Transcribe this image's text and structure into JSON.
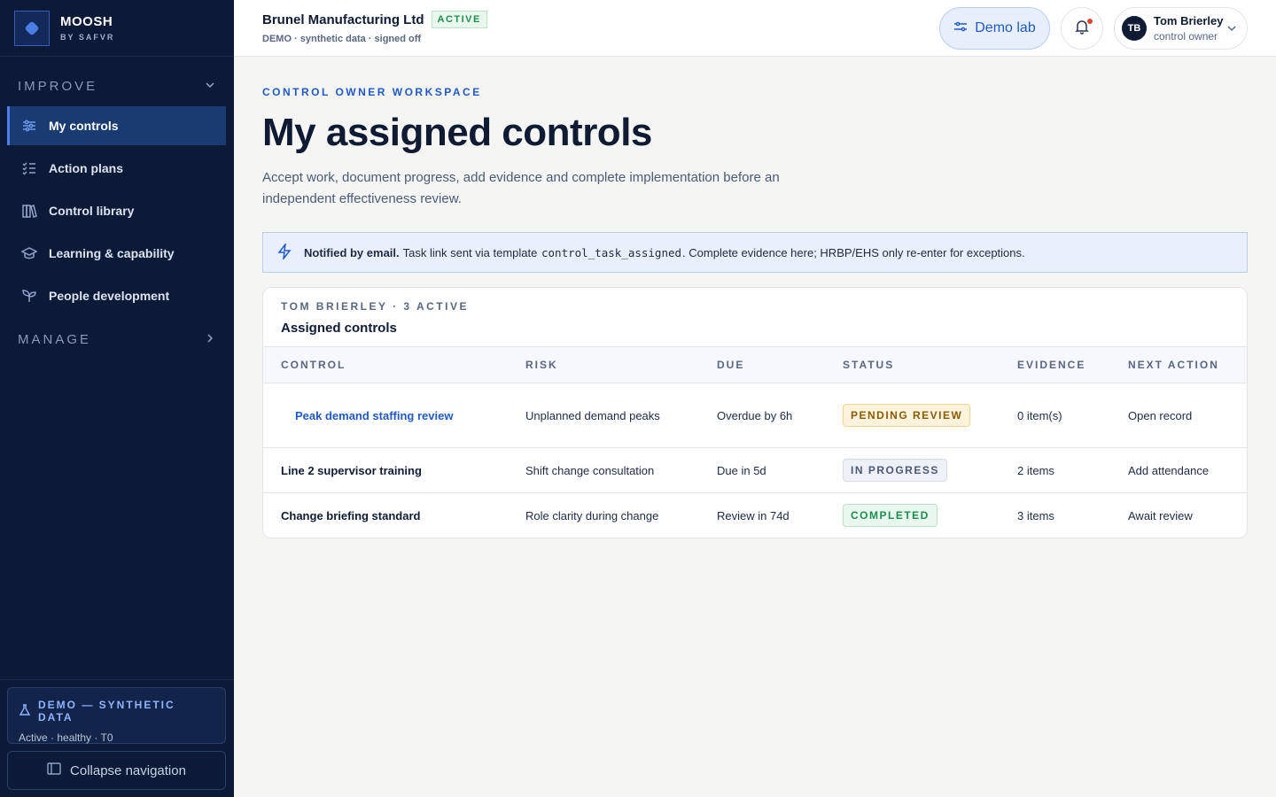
{
  "brand": {
    "name": "MOOSH",
    "sub": "BY SAFVR"
  },
  "sidebar": {
    "improve_label": "IMPROVE",
    "manage_label": "MANAGE",
    "items": [
      {
        "label": "My controls",
        "icon": "sliders-icon"
      },
      {
        "label": "Action plans",
        "icon": "checklist-icon"
      },
      {
        "label": "Control library",
        "icon": "books-icon"
      },
      {
        "label": "Learning & capability",
        "icon": "graduation-cap-icon"
      },
      {
        "label": "People development",
        "icon": "sprout-icon"
      }
    ],
    "demo_title": "DEMO — SYNTHETIC DATA",
    "demo_status": "Active · healthy · T0",
    "collapse_label": "Collapse navigation"
  },
  "header": {
    "org_name": "Brunel Manufacturing Ltd",
    "org_badge": "ACTIVE",
    "org_sub": "DEMO · synthetic data · signed off",
    "demo_lab_label": "Demo lab",
    "user_initials": "TB",
    "user_name": "Tom Brierley",
    "user_role": "control owner"
  },
  "main": {
    "eyebrow": "CONTROL OWNER WORKSPACE",
    "title": "My assigned controls",
    "description": "Accept work, document progress, add evidence and complete implementation before an independent effectiveness review.",
    "notice_bold": "Notified by email.",
    "notice_pre": "Task link sent via template",
    "notice_code": "control_task_assigned",
    "notice_post": ". Complete evidence here; HRBP/EHS only re-enter for exceptions."
  },
  "table": {
    "eyebrow": "TOM BRIERLEY · 3 ACTIVE",
    "title": "Assigned controls",
    "columns": [
      "CONTROL",
      "RISK",
      "DUE",
      "STATUS",
      "EVIDENCE",
      "NEXT ACTION"
    ],
    "rows": [
      {
        "control": "Peak demand staffing review",
        "risk": "Unplanned demand peaks",
        "due": "Overdue by 6h",
        "status": "PENDING REVIEW",
        "evidence": "0 item(s)",
        "next": "Open record"
      },
      {
        "control": "Line 2 supervisor training",
        "risk": "Shift change consultation",
        "due": "Due in 5d",
        "status": "IN PROGRESS",
        "evidence": "2 items",
        "next": "Add attendance"
      },
      {
        "control": "Change briefing standard",
        "risk": "Role clarity during change",
        "due": "Review in 74d",
        "status": "COMPLETED",
        "evidence": "3 items",
        "next": "Await review"
      }
    ]
  },
  "colors": {
    "sidebar_bg": "#0c1a37",
    "accent": "#1f5ac5",
    "active_green": "#1b8f4e",
    "pending_amber": "#8a5a00",
    "notify_dot": "#e0433b"
  }
}
